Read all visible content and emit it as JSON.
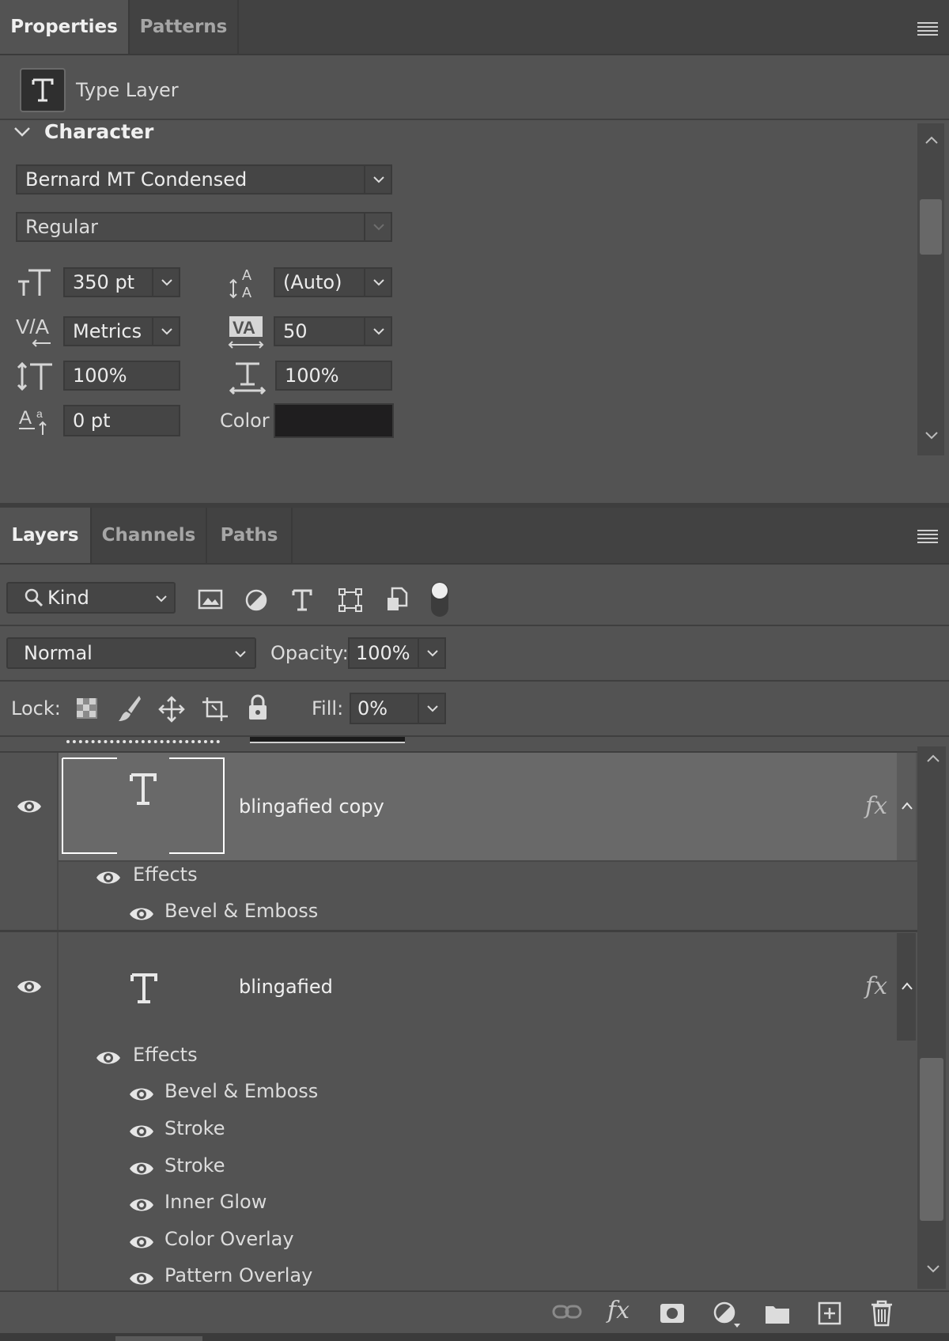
{
  "properties_panel": {
    "tabs": [
      "Properties",
      "Patterns"
    ],
    "layer_type": "Type Layer",
    "section_title": "Character",
    "font_family": "Bernard MT Condensed",
    "font_style": "Regular",
    "font_size": "350 pt",
    "leading": "(Auto)",
    "kerning": "Metrics",
    "tracking": "50",
    "vertical_scale": "100%",
    "horizontal_scale": "100%",
    "baseline_shift": "0 pt",
    "color_label": "Color",
    "color_value": "#1f1e1f"
  },
  "layers_panel": {
    "tabs": [
      "Layers",
      "Channels",
      "Paths"
    ],
    "filter_kind": "Kind",
    "blend_mode": "Normal",
    "opacity_label": "Opacity:",
    "opacity": "100%",
    "lock_label": "Lock:",
    "fill_label": "Fill:",
    "fill": "0%",
    "fx_label": "fx",
    "layers": [
      {
        "name": "blingafied copy",
        "effects_label": "Effects",
        "effects": [
          "Bevel & Emboss"
        ]
      },
      {
        "name": "blingafied",
        "effects_label": "Effects",
        "effects": [
          "Bevel & Emboss",
          "Stroke",
          "Stroke",
          "Inner Glow",
          "Color Overlay",
          "Pattern Overlay"
        ]
      }
    ],
    "footer_icons": [
      "link-icon",
      "fx-icon",
      "mask-icon",
      "adjustment-icon",
      "folder-icon",
      "new-layer-icon",
      "trash-icon"
    ]
  },
  "colors": {
    "panel_bg": "#535353",
    "tabbar_bg": "#424242",
    "field_bg": "#454545",
    "selected_row": "#696969"
  }
}
